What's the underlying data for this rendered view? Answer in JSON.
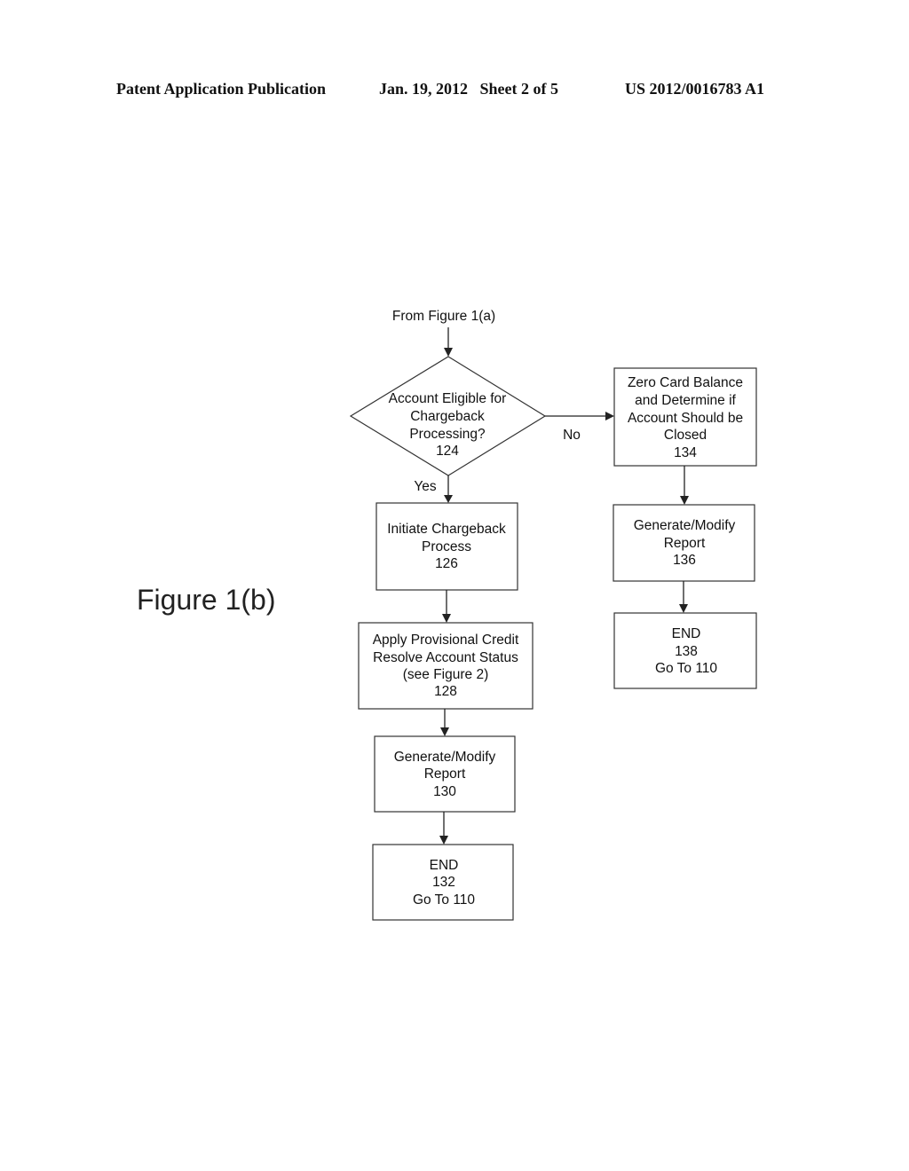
{
  "header": {
    "publication": "Patent Application Publication",
    "date_sheet": "Jan. 19, 2012   Sheet 2 of 5",
    "number": "US 2012/0016783 A1"
  },
  "figure_label": "Figure 1(b)",
  "flow": {
    "entry": "From Figure 1(a)",
    "decision": {
      "lines": [
        "Account Eligible for",
        "Chargeback",
        "Processing?",
        "124"
      ]
    },
    "yes_label": "Yes",
    "no_label": "No",
    "left_branch": [
      {
        "lines": [
          "Initiate Chargeback",
          "Process",
          "126"
        ]
      },
      {
        "lines": [
          "Apply Provisional Credit",
          "Resolve Account Status",
          "(see Figure 2)",
          "128"
        ]
      },
      {
        "lines": [
          "Generate/Modify",
          "Report",
          "130"
        ]
      },
      {
        "lines": [
          "END",
          "132",
          "Go To 110"
        ]
      }
    ],
    "right_branch": [
      {
        "lines": [
          "Zero Card Balance",
          "and Determine if",
          "Account Should be",
          "Closed",
          "134"
        ]
      },
      {
        "lines": [
          "Generate/Modify",
          "Report",
          "136"
        ]
      },
      {
        "lines": [
          "END",
          "138",
          "Go To 110"
        ]
      }
    ]
  }
}
